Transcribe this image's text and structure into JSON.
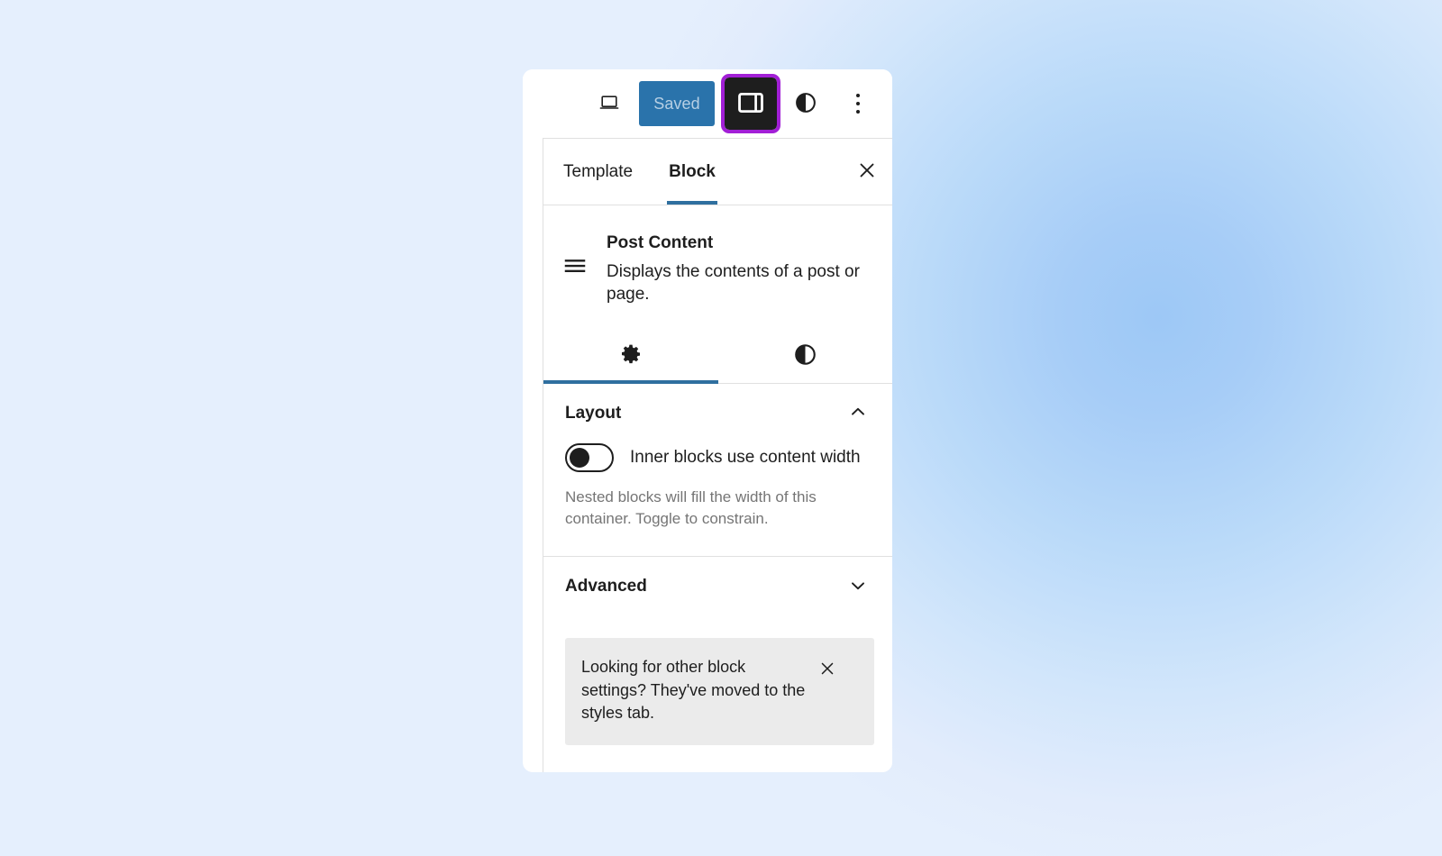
{
  "background": {
    "base_color": "#e4edfc",
    "glow_color": "#9dc8f6"
  },
  "canvas": {
    "selection_outline_color": "#2f6f9f"
  },
  "toolbar": {
    "device_preview_icon": "laptop-icon",
    "save_label": "Saved",
    "save_button_color": "#2a73ab",
    "save_text_color": "#b6cfe4",
    "sidebar_toggle_icon": "sidebar-panel-icon",
    "sidebar_toggle_focus_color": "#a21fd6",
    "styles_icon": "half-circle-contrast-icon",
    "options_icon": "vertical-ellipsis-icon"
  },
  "sidebar": {
    "tabs": [
      {
        "label": "Template",
        "active": false
      },
      {
        "label": "Block",
        "active": true
      }
    ],
    "active_tab_underline_color": "#2f6f9f",
    "close_icon": "close-x-icon",
    "block": {
      "icon": "post-content-lines-icon",
      "title": "Post Content",
      "description": "Displays the contents of a post or page."
    },
    "inspector_tabs": [
      {
        "icon": "gear-icon",
        "name": "settings",
        "active": true
      },
      {
        "icon": "half-circle-contrast-icon",
        "name": "styles",
        "active": false
      }
    ],
    "sections": [
      {
        "title": "Layout",
        "expanded": true,
        "chevron_icon": "chevron-up-icon",
        "toggle": {
          "label": "Inner blocks use content width",
          "checked": false
        },
        "help_text": "Nested blocks will fill the width of this container. Toggle to constrain."
      },
      {
        "title": "Advanced",
        "expanded": false,
        "chevron_icon": "chevron-down-icon"
      }
    ],
    "notice": {
      "message": "Looking for other block settings? They've moved to the styles tab.",
      "dismiss_icon": "close-x-icon",
      "background_color": "#ebebeb"
    }
  }
}
